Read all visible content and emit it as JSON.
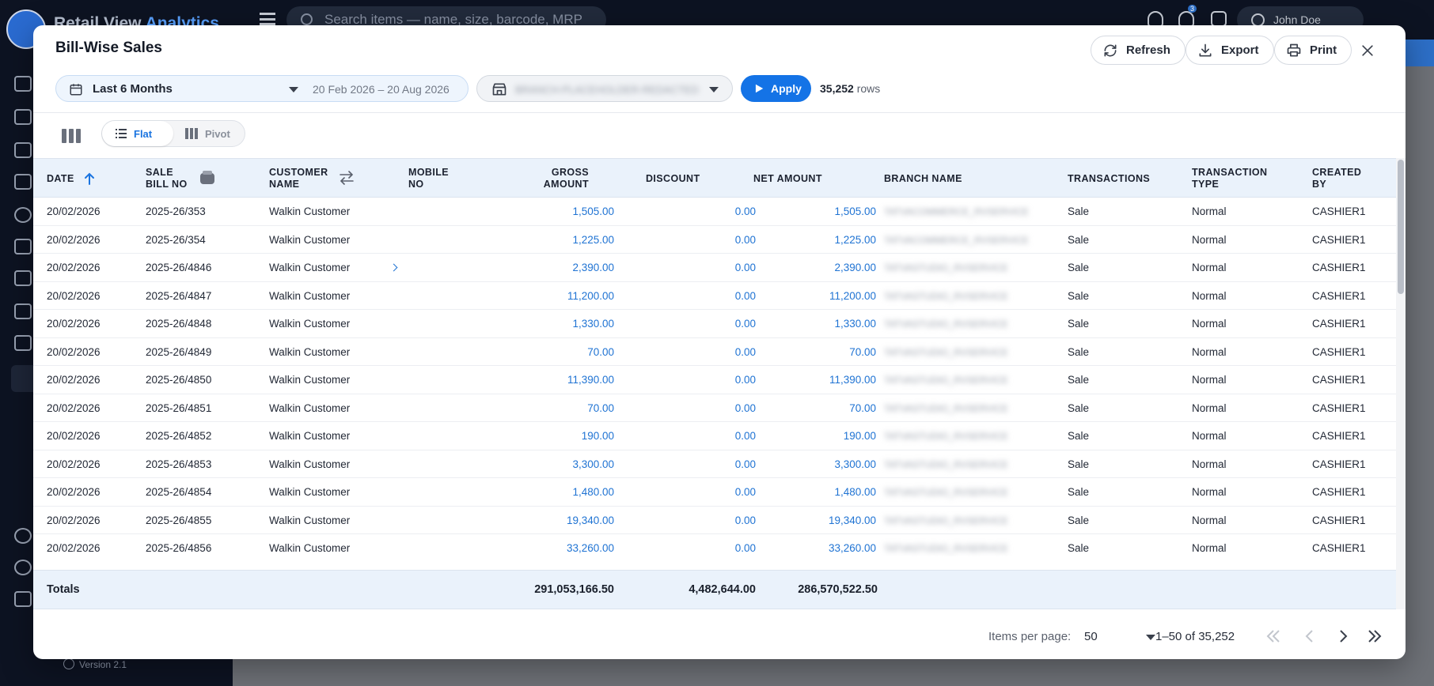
{
  "background": {
    "brand_name": "Retail View",
    "brand_accent": "Analytics",
    "search_placeholder": "Search items — name, size, barcode, MRP",
    "notification_count": "3",
    "user_name": "John Doe",
    "version": "Version 2.1"
  },
  "modal": {
    "title": "Bill-Wise Sales",
    "actions": {
      "refresh": "Refresh",
      "export": "Export",
      "print": "Print"
    },
    "filters": {
      "period": "Last 6 Months",
      "date_range": "20 Feb 2026 – 20 Aug 2026",
      "branch_value": "BRANCH-PLACEHOLDER-REDACTED",
      "apply": "Apply",
      "row_count": "35,252",
      "row_suffix": "rows"
    },
    "view": {
      "flat": "Flat",
      "pivot": "Pivot"
    }
  },
  "table": {
    "columns": {
      "date": "DATE",
      "sale_bill_no_1": "SALE",
      "sale_bill_no_2": "BILL NO",
      "customer_name_1": "CUSTOMER",
      "customer_name_2": "NAME",
      "mobile_no_1": "MOBILE",
      "mobile_no_2": "NO",
      "gross_amount_1": "GROSS",
      "gross_amount_2": "AMOUNT",
      "discount": "DISCOUNT",
      "net_amount": "NET AMOUNT",
      "branch_name": "BRANCH NAME",
      "transactions": "TRANSACTIONS",
      "transaction_type_1": "TRANSACTION",
      "transaction_type_2": "TYPE",
      "created_by_1": "CREATED",
      "created_by_2": "BY"
    },
    "rows": [
      {
        "date": "20/02/2026",
        "bill": "2025-26/353",
        "customer": "Walkin Customer",
        "gross": "1,505.00",
        "discount": "0.00",
        "net": "1,505.00",
        "branch": "TATVACOMMERCE_RVSERVICE",
        "transactions": "Sale",
        "type": "Normal",
        "created_by": "CASHIER1"
      },
      {
        "date": "20/02/2026",
        "bill": "2025-26/354",
        "customer": "Walkin Customer",
        "gross": "1,225.00",
        "discount": "0.00",
        "net": "1,225.00",
        "branch": "TATVACOMMERCE_RVSERVICE",
        "transactions": "Sale",
        "type": "Normal",
        "created_by": "CASHIER1"
      },
      {
        "date": "20/02/2026",
        "bill": "2025-26/4846",
        "customer": "Walkin Customer",
        "gross": "2,390.00",
        "discount": "0.00",
        "net": "2,390.00",
        "branch": "TATVASTUDIO_RVSERVICE",
        "transactions": "Sale",
        "type": "Normal",
        "created_by": "CASHIER1"
      },
      {
        "date": "20/02/2026",
        "bill": "2025-26/4847",
        "customer": "Walkin Customer",
        "gross": "11,200.00",
        "discount": "0.00",
        "net": "11,200.00",
        "branch": "TATVASTUDIO_RVSERVICE",
        "transactions": "Sale",
        "type": "Normal",
        "created_by": "CASHIER1"
      },
      {
        "date": "20/02/2026",
        "bill": "2025-26/4848",
        "customer": "Walkin Customer",
        "gross": "1,330.00",
        "discount": "0.00",
        "net": "1,330.00",
        "branch": "TATVASTUDIO_RVSERVICE",
        "transactions": "Sale",
        "type": "Normal",
        "created_by": "CASHIER1"
      },
      {
        "date": "20/02/2026",
        "bill": "2025-26/4849",
        "customer": "Walkin Customer",
        "gross": "70.00",
        "discount": "0.00",
        "net": "70.00",
        "branch": "TATVASTUDIO_RVSERVICE",
        "transactions": "Sale",
        "type": "Normal",
        "created_by": "CASHIER1"
      },
      {
        "date": "20/02/2026",
        "bill": "2025-26/4850",
        "customer": "Walkin Customer",
        "gross": "11,390.00",
        "discount": "0.00",
        "net": "11,390.00",
        "branch": "TATVASTUDIO_RVSERVICE",
        "transactions": "Sale",
        "type": "Normal",
        "created_by": "CASHIER1"
      },
      {
        "date": "20/02/2026",
        "bill": "2025-26/4851",
        "customer": "Walkin Customer",
        "gross": "70.00",
        "discount": "0.00",
        "net": "70.00",
        "branch": "TATVASTUDIO_RVSERVICE",
        "transactions": "Sale",
        "type": "Normal",
        "created_by": "CASHIER1"
      },
      {
        "date": "20/02/2026",
        "bill": "2025-26/4852",
        "customer": "Walkin Customer",
        "gross": "190.00",
        "discount": "0.00",
        "net": "190.00",
        "branch": "TATVASTUDIO_RVSERVICE",
        "transactions": "Sale",
        "type": "Normal",
        "created_by": "CASHIER1"
      },
      {
        "date": "20/02/2026",
        "bill": "2025-26/4853",
        "customer": "Walkin Customer",
        "gross": "3,300.00",
        "discount": "0.00",
        "net": "3,300.00",
        "branch": "TATVASTUDIO_RVSERVICE",
        "transactions": "Sale",
        "type": "Normal",
        "created_by": "CASHIER1"
      },
      {
        "date": "20/02/2026",
        "bill": "2025-26/4854",
        "customer": "Walkin Customer",
        "gross": "1,480.00",
        "discount": "0.00",
        "net": "1,480.00",
        "branch": "TATVASTUDIO_RVSERVICE",
        "transactions": "Sale",
        "type": "Normal",
        "created_by": "CASHIER1"
      },
      {
        "date": "20/02/2026",
        "bill": "2025-26/4855",
        "customer": "Walkin Customer",
        "gross": "19,340.00",
        "discount": "0.00",
        "net": "19,340.00",
        "branch": "TATVASTUDIO_RVSERVICE",
        "transactions": "Sale",
        "type": "Normal",
        "created_by": "CASHIER1"
      },
      {
        "date": "20/02/2026",
        "bill": "2025-26/4856",
        "customer": "Walkin Customer",
        "gross": "33,260.00",
        "discount": "0.00",
        "net": "33,260.00",
        "branch": "TATVASTUDIO_RVSERVICE",
        "transactions": "Sale",
        "type": "Normal",
        "created_by": "CASHIER1"
      }
    ],
    "totals": {
      "label": "Totals",
      "gross": "291,053,166.50",
      "discount": "4,482,644.00",
      "net": "286,570,522.50"
    }
  },
  "paginator": {
    "items_per_page_label": "Items per page:",
    "items_per_page": "50",
    "range": "1–50 of 35,252"
  },
  "colors": {
    "accent": "#1473e6",
    "header_bg": "#eaf2fb",
    "amount_text": "#1f73d3"
  }
}
